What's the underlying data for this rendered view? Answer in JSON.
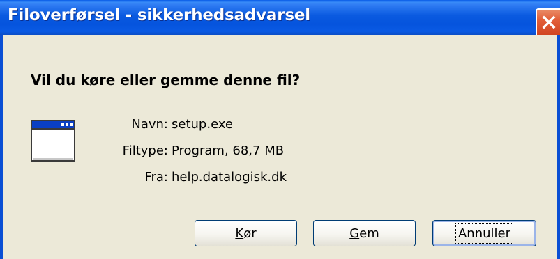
{
  "window": {
    "title": "Filoverførsel - sikkerhedsadvarsel"
  },
  "question": "Vil du køre eller gemme denne fil?",
  "file": {
    "icon": "program-window-icon",
    "name_label": "Navn:",
    "name_value": "setup.exe",
    "type_label": "Filtype:",
    "type_value": "Program, 68,7 MB",
    "from_label": "Fra:",
    "from_value": "help.datalogisk.dk"
  },
  "buttons": {
    "run": {
      "underline": "K",
      "rest": "ør"
    },
    "save": {
      "underline": "G",
      "rest": "em"
    },
    "cancel": {
      "label": "Annuller"
    }
  },
  "colors": {
    "titlebar": "#0a5ae0",
    "close": "#e25f39",
    "background": "#ece9d8"
  }
}
